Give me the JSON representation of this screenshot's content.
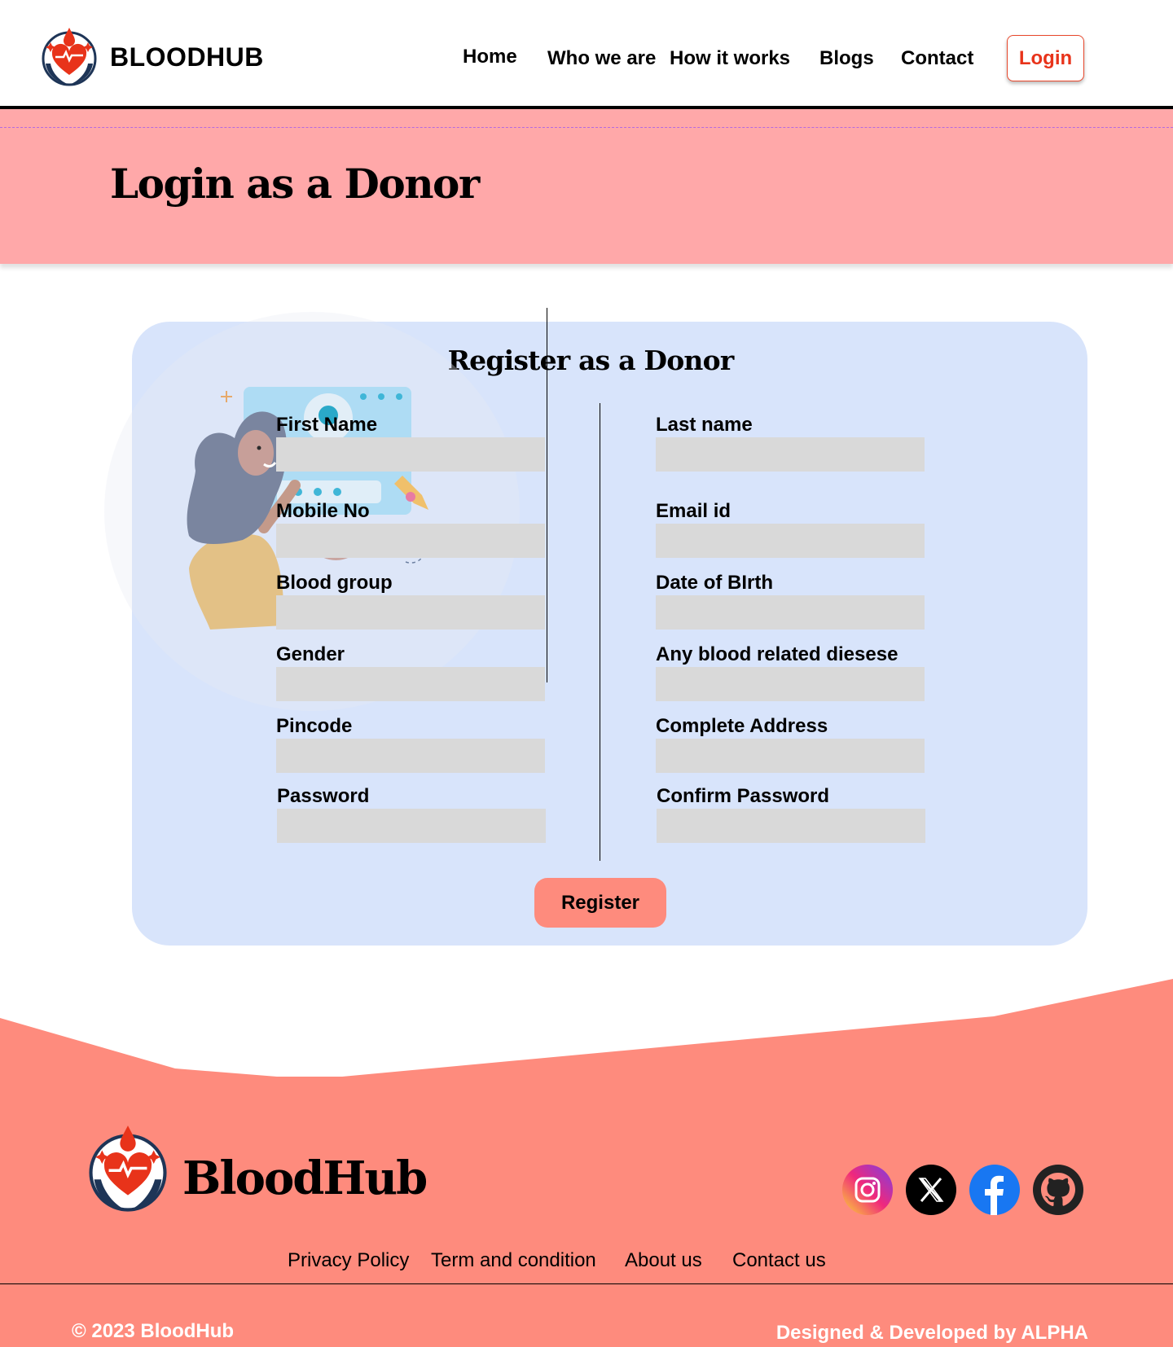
{
  "header": {
    "brand": "BLOODHUB",
    "nav": [
      {
        "label": "Home"
      },
      {
        "label": "Who we are"
      },
      {
        "label": "How it works"
      },
      {
        "label": "Blogs"
      },
      {
        "label": "Contact"
      }
    ],
    "login_label": "Login"
  },
  "hero": {
    "title": "Login as a Donor"
  },
  "form": {
    "title": "Register as a Donor",
    "fields": {
      "first_name": "First Name",
      "last_name": "Last name",
      "mobile": "Mobile No",
      "email": "Email id",
      "blood_group": "Blood group",
      "dob": "Date of BIrth",
      "gender": "Gender",
      "disease": "Any blood related diesese",
      "pincode": "Pincode",
      "address": "Complete Address",
      "password": "Password",
      "confirm_password": "Confirm Password"
    },
    "submit_label": "Register"
  },
  "footer": {
    "brand": "BloodHub",
    "social": [
      {
        "icon": "instagram-icon"
      },
      {
        "icon": "x-icon"
      },
      {
        "icon": "facebook-icon"
      },
      {
        "icon": "github-icon"
      }
    ],
    "links": [
      {
        "label": "Privacy Policy"
      },
      {
        "label": "Term and condition"
      },
      {
        "label": "About us"
      },
      {
        "label": "Contact us"
      }
    ],
    "copyright": "© 2023 BloodHub",
    "credit": "Designed & Developed by ALPHA"
  },
  "colors": {
    "accent": "#e8331a",
    "band": "#ffa8a9",
    "card": "#d8e4fb",
    "footer": "#fe8b7d",
    "input": "#d9d9d9"
  }
}
